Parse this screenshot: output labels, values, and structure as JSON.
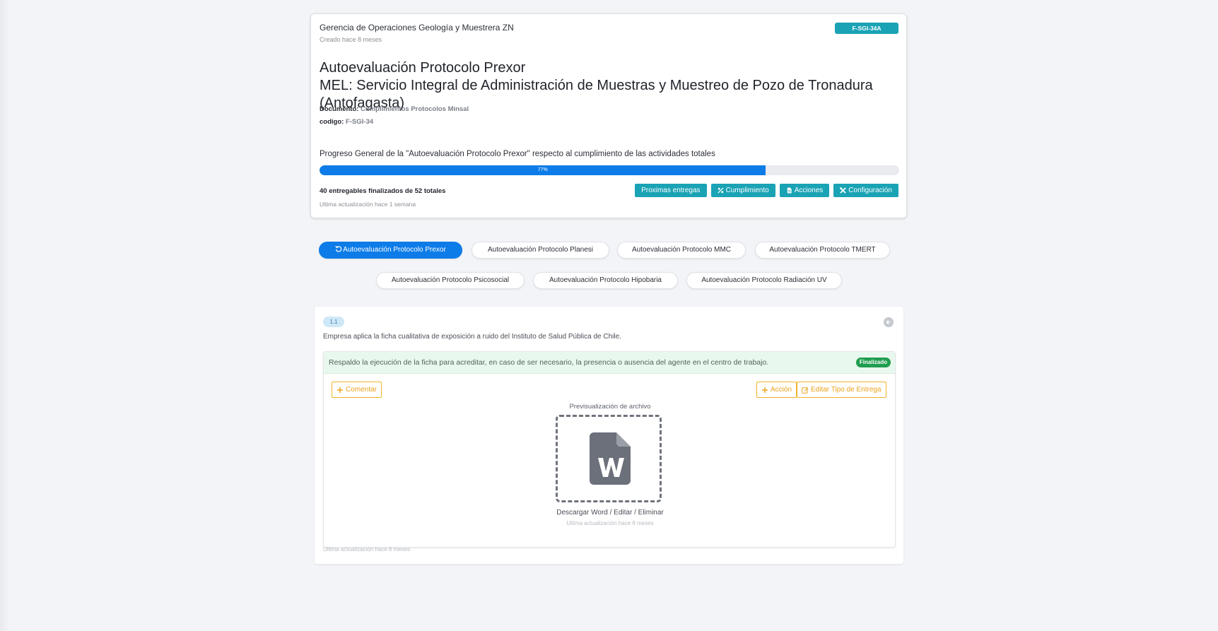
{
  "header": {
    "org": "Gerencia de Operaciones Geología y Muestrera ZN",
    "created": "Creado hace 8 meses",
    "code_badge": "F-SGI-34A",
    "title_line1": "Autoevaluación Protocolo Prexor",
    "title_line2": "MEL: Servicio Integral de Administración de Muestras y Muestreo de Pozo de Tronadura (Antofagasta)",
    "documento_label": "Documento:",
    "documento_value": "Cumplimientos Protocolos Minsal",
    "codigo_label": "codigo:",
    "codigo_value": "F-SGI-34",
    "progress_text": "Progreso General de la \"Autoevaluación Protocolo Prexor\" respecto al cumplimiento de las actividades totales",
    "progress_percent": 77,
    "progress_label": "77%",
    "deliverables": "40 entregables finalizados de 52 totales",
    "updated": "Ultima actualización hace 1 semana",
    "buttons": {
      "proximas": "Proximas entregas",
      "cumplimiento": "Cumplimiento",
      "acciones": "Acciones",
      "configuracion": "Configuración"
    }
  },
  "tabs": [
    {
      "label": "Autoevaluación Protocolo Prexor",
      "active": true
    },
    {
      "label": "Autoevaluación Protocolo Planesi"
    },
    {
      "label": "Autoevaluación Protocolo MMC"
    },
    {
      "label": "Autoevaluación Protocolo TMERT"
    },
    {
      "label": "Autoevaluación Protocolo Psicosocial"
    },
    {
      "label": "Autoevaluación Protocolo Hipobaria"
    },
    {
      "label": "Autoevaluación Protocolo Radiación UV"
    }
  ],
  "item": {
    "number": "1.1",
    "description": "Empresa aplica la ficha cualitativa de exposición a ruido del Instituto de Salud Pública de Chile.",
    "deliverable_text": "Respaldo la ejecución de la ficha para acreditar, en caso de ser necesario, la presencia o ausencia del agente en el centro de trabajo.",
    "status": "Finalizado",
    "comment_btn": "Comentar",
    "action_btn": "Acción",
    "edit_btn": "Editar Tipo de Entrega",
    "preview_label": "Previsualización de archivo",
    "download_link": "Descargar Word / Editar / Eliminar",
    "inner_updated": "Ultima actualización hace 8 meses",
    "card_updated": "Ultima actualización hace 8 meses"
  },
  "colors": {
    "teal": "#1aa3b5",
    "blue": "#0d7ce8",
    "green": "#1f9d4f",
    "amber": "#eda21b"
  }
}
